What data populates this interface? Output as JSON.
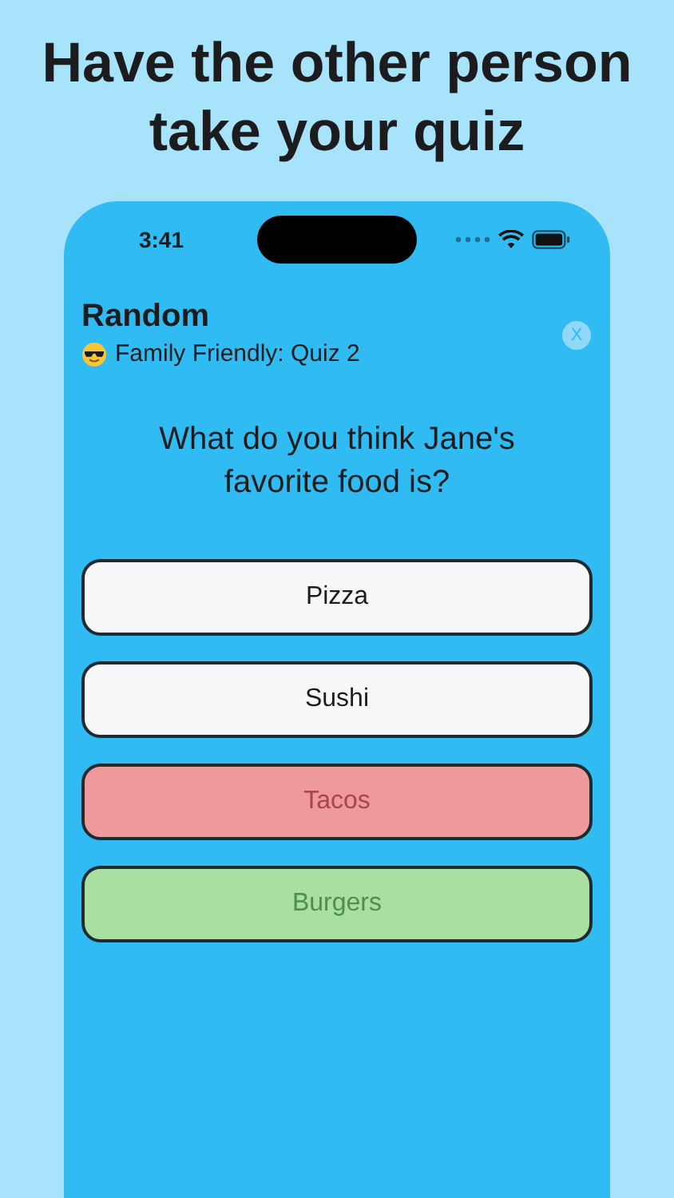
{
  "headline": "Have the other person take your quiz",
  "status_bar": {
    "time": "3:41"
  },
  "header": {
    "title": "Random",
    "subtitle": "Family Friendly: Quiz 2",
    "close": "X"
  },
  "question": "What do you think Jane's favorite food is?",
  "options": [
    {
      "label": "Pizza",
      "kind": "plain"
    },
    {
      "label": "Sushi",
      "kind": "plain"
    },
    {
      "label": "Tacos",
      "kind": "wrong"
    },
    {
      "label": "Burgers",
      "kind": "correct"
    }
  ]
}
